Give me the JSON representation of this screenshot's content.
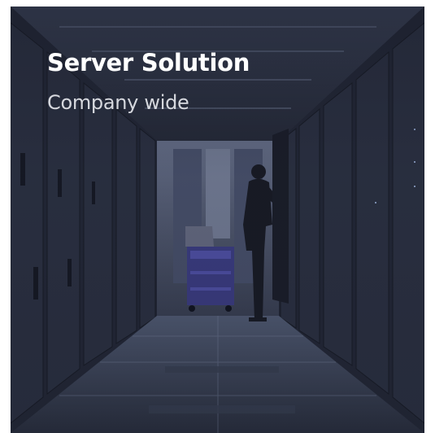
{
  "card": {
    "title": "Server Solution",
    "subtitle": "Company wide"
  },
  "colors": {
    "title": "#ffffff",
    "subtitle": "#d6d8de",
    "overlay": "#1b1f2b"
  },
  "image": {
    "subject": "server-room-aisle-icon"
  }
}
